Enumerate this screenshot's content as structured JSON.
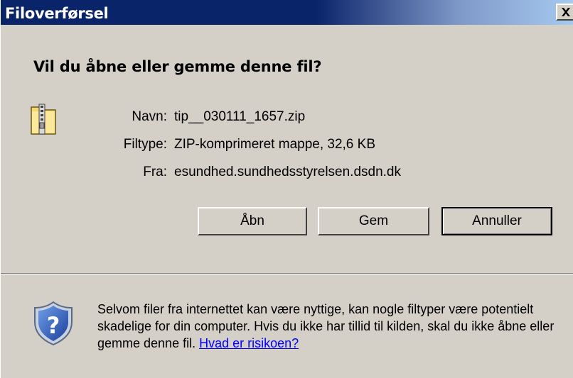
{
  "window": {
    "title": "Filoverførsel",
    "close_symbol": "X"
  },
  "question": "Vil du åbne eller gemme denne fil?",
  "file_info": {
    "icon": "zip-folder-icon",
    "name_label": "Navn:",
    "name_value": "tip__030111_1657.zip",
    "type_label": "Filtype:",
    "type_value": "ZIP-komprimeret mappe, 32,6 KB",
    "from_label": "Fra:",
    "from_value": "esundhed.sundhedsstyrelsen.dsdn.dk"
  },
  "buttons": {
    "open": "Åbn",
    "save": "Gem",
    "cancel": "Annuller"
  },
  "warning": {
    "icon": "shield-question-icon",
    "text": "Selvom filer fra internettet kan være nyttige, kan nogle filtyper være potentielt skadelige for din computer. Hvis du ikke har tillid til kilden, skal du ikke åbne eller gemme denne fil.",
    "link": "Hvad er risikoen?"
  }
}
